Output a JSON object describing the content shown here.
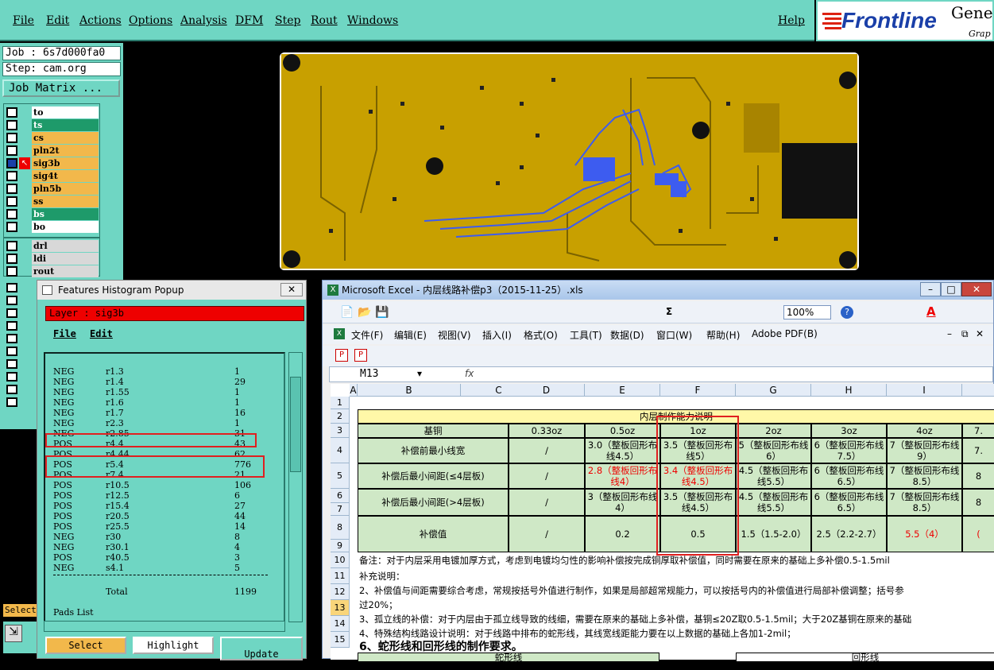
{
  "menu": {
    "file": "File",
    "edit": "Edit",
    "actions": "Actions",
    "options": "Options",
    "analysis": "Analysis",
    "dfm": "DFM",
    "step": "Step",
    "rout": "Rout",
    "windows": "Windows",
    "help": "Help"
  },
  "logo": {
    "brand": "Frontline",
    "sub1": "Gene",
    "sub2": "Grap"
  },
  "job": {
    "job": "Job : 6s7d000fa0",
    "step": "Step: cam.org",
    "matrix": "Job Matrix ..."
  },
  "layers": [
    {
      "name": "to",
      "color": "#ffffff"
    },
    {
      "name": "ts",
      "color": "#1e9a6a"
    },
    {
      "name": "cs",
      "color": "#f2b84b"
    },
    {
      "name": "pln2t",
      "color": "#f2b84b"
    },
    {
      "name": "sig3b",
      "color": "#f2b84b"
    },
    {
      "name": "sig4t",
      "color": "#f2b84b"
    },
    {
      "name": "pln5b",
      "color": "#f2b84b"
    },
    {
      "name": "ss",
      "color": "#f2b84b"
    },
    {
      "name": "bs",
      "color": "#1e9a6a"
    },
    {
      "name": "bo",
      "color": "#ffffff"
    }
  ],
  "drill_layers": [
    {
      "name": "drl"
    },
    {
      "name": "ldi"
    },
    {
      "name": "rout"
    }
  ],
  "select_tab": "Select",
  "histogram": {
    "title": "Features Histogram Popup",
    "layer": "Layer : sig3b",
    "menu_file": "File",
    "menu_edit": "Edit",
    "rows": [
      [
        "NEG",
        "r1.3",
        "1"
      ],
      [
        "NEG",
        "r1.4",
        "29"
      ],
      [
        "NEG",
        "r1.55",
        "1"
      ],
      [
        "NEG",
        "r1.6",
        "1"
      ],
      [
        "NEG",
        "r1.7",
        "16"
      ],
      [
        "NEG",
        "r2.3",
        "1"
      ],
      [
        "NEG",
        "r2.85",
        "31"
      ],
      [
        "POS",
        "r4.4",
        "43"
      ],
      [
        "POS",
        "r4.44",
        "62"
      ],
      [
        "POS",
        "r5.4",
        "776"
      ],
      [
        "POS",
        "r7.4",
        "21"
      ],
      [
        "POS",
        "r10.5",
        "106"
      ],
      [
        "POS",
        "r12.5",
        "6"
      ],
      [
        "POS",
        "r15.4",
        "27"
      ],
      [
        "POS",
        "r20.5",
        "44"
      ],
      [
        "POS",
        "r25.5",
        "14"
      ],
      [
        "NEG",
        "r30",
        "8"
      ],
      [
        "NEG",
        "r30.1",
        "4"
      ],
      [
        "POS",
        "r40.5",
        "3"
      ],
      [
        "NEG",
        "s4.1",
        "5"
      ]
    ],
    "total_label": "Total",
    "total": "1199",
    "pads_list": "Pads List",
    "select": "Select",
    "highlight": "Highlight",
    "update": "Update"
  },
  "excel": {
    "title": "Microsoft Excel - 内层线路补偿p3（2015-11-25）.xls",
    "menu": [
      "文件(F)",
      "编辑(E)",
      "视图(V)",
      "插入(I)",
      "格式(O)",
      "工具(T)",
      "数据(D)",
      "窗口(W)",
      "帮助(H)",
      "Adobe PDF(B)"
    ],
    "zoom": "100%",
    "namebox": "M13",
    "fx": "fx",
    "cols": [
      "A",
      "B",
      "C",
      "D",
      "E",
      "F",
      "G",
      "H",
      "I"
    ],
    "rows": [
      "1",
      "2",
      "3",
      "4",
      "5",
      "6",
      "7",
      "8",
      "9",
      "10",
      "11",
      "12",
      "13",
      "14",
      "15"
    ],
    "table_title": "内层制作能力说明",
    "hdr": [
      "基铜",
      "0.33oz",
      "0.5oz",
      "1oz",
      "2oz",
      "3oz",
      "4oz",
      "7."
    ],
    "r4": [
      "补偿前最小线宽",
      "/",
      "3.0（整板回形布线4.5）",
      "3.5（整板回形布线5）",
      "5（整板回形布线6）",
      "6（整板回形布线7.5）",
      "7（整板回形布线9）",
      "7."
    ],
    "r5": [
      "补偿后最小间距(≤4层板)",
      "/",
      "2.8（整板回形布线4）",
      "3.4（整板回形布线4.5）",
      "4.5（整板回形布线5.5）",
      "6（整板回形布线6.5）",
      "7（整板回形布线8.5）",
      "8"
    ],
    "r6": [
      "补偿后最小间距(>4层板)",
      "/",
      "3（整板回形布线4）",
      "3.5（整板回形布线4.5）",
      "4.5（整板回形布线5.5）",
      "6（整板回形布线6.5）",
      "7（整板回形布线8.5）",
      "8"
    ],
    "r7": [
      "补偿值",
      "/",
      "0.2",
      "0.5",
      "1.5（1.5-2.0）",
      "2.5（2.2-2.7）",
      "5.5（4）",
      "("
    ],
    "note9": "备注：对于内层采用电镀加厚方式，考虑到电镀均匀性的影响补偿按完成铜厚取补偿值，同时需要在原来的基础上多补偿0.5-1.5mil",
    "note10": "补充说明：",
    "note11": "2、补偿值与间距需要综合考虑，常规按括号外值进行制作，如果是局部超常规能力，可以按括号内的补偿值进行局部补偿调整；括号参",
    "note12": "过20%；",
    "note13": "3、孤立线的补偿：对于内层由于孤立线导致的线细，需要在原来的基础上多补偿，基铜≤20Z取0.5-1.5mil；大于20Z基铜在原来的基础",
    "note14": "4、特殊结构线路设计说明：对于线路中排布的蛇形线，其线宽线距能力要在以上数据的基础上各加1-2mil；",
    "note15": "6、蛇形线和回形线的制作要求。",
    "r16a": "蛇形线",
    "r16b": "回形线"
  },
  "colors": {
    "accent": "#6fd6c3",
    "board": "#c8a000",
    "copper_blue": "#3d5cf0"
  }
}
